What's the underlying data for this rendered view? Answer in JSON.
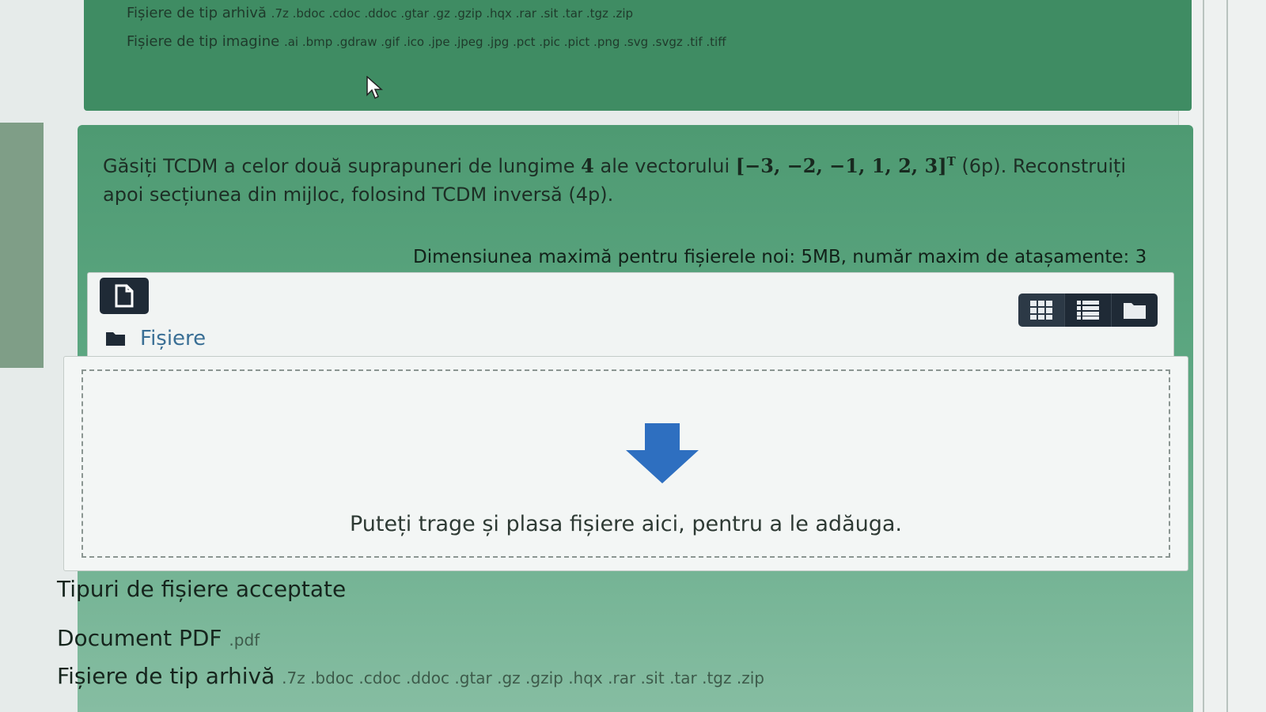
{
  "top_panel": {
    "archive_label": "Fișiere de tip arhivă",
    "archive_exts": ".7z .bdoc .cdoc .ddoc .gtar .gz .gzip .hqx .rar .sit .tar .tgz .zip",
    "image_label": "Fișiere de tip imagine",
    "image_exts": ".ai .bmp .gdraw .gif .ico .jpe .jpeg .jpg .pct .pic .pict .png .svg .svgz .tif .tiff"
  },
  "question": {
    "text_before": "Găsiți TCDM a celor două suprapuneri de lungime",
    "n": "4",
    "text_mid": "ale vectorului",
    "vector": "[−3, −2, −1, 1, 2, 3]",
    "transpose": "T",
    "text_after": "(6p). Reconstruiți apoi secțiunea din mijloc, folosind TCDM inversă (4p)."
  },
  "upload": {
    "limit_note": "Dimensiunea maximă pentru fișierele noi: 5MB, număr maxim de atașamente: 3",
    "path_label": "Fișiere",
    "drop_text": "Puteți trage și plasa fișiere aici, pentru a le adăuga."
  },
  "accepted": {
    "title": "Tipuri de fișiere acceptate",
    "types": [
      {
        "label": "Document PDF",
        "exts": ".pdf"
      },
      {
        "label": "Fișiere de tip arhivă",
        "exts": ".7z .bdoc .cdoc .ddoc .gtar .gz .gzip .hqx .rar .sit .tar .tgz .zip"
      }
    ]
  },
  "icons": {
    "add_file": "file-add-icon",
    "view_grid": "grid-view-icon",
    "view_list": "list-view-icon",
    "view_tree": "folder-view-icon",
    "folder": "folder-icon",
    "drop_arrow": "download-arrow-icon"
  },
  "colors": {
    "panel_green": "#4e9a72",
    "dark_button": "#1f2a36",
    "arrow_blue": "#2e6fc0",
    "link_blue": "#3a6f95"
  }
}
